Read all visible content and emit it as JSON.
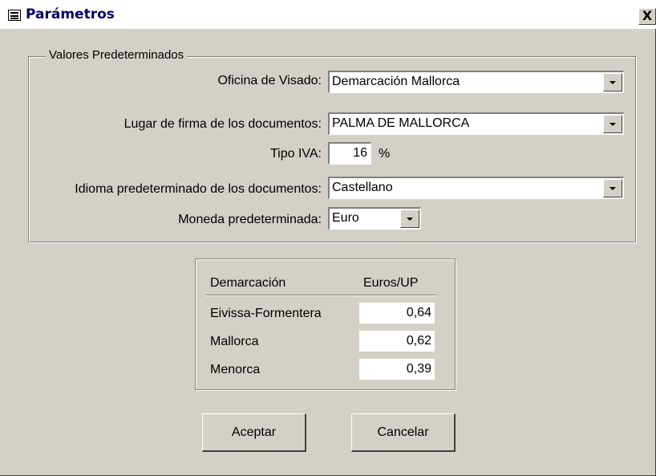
{
  "window": {
    "title": "Parámetros",
    "close_glyph": "X",
    "icon": "form-icon"
  },
  "defaults": {
    "legend": "Valores Predeterminados",
    "oficina": {
      "label": "Oficina de Visado:",
      "value": "Demarcación Mallorca"
    },
    "lugar": {
      "label": "Lugar de firma de los documentos:",
      "value": "PALMA DE MALLORCA"
    },
    "iva": {
      "label": "Tipo IVA:",
      "value": "16",
      "unit": "%"
    },
    "idioma": {
      "label": "Idioma predeterminado de los documentos:",
      "value": "Castellano"
    },
    "moneda": {
      "label": "Moneda predeterminada:",
      "value": "Euro"
    }
  },
  "rates": {
    "headers": [
      "Demarcación",
      "Euros/UP"
    ],
    "rows": [
      {
        "name": "Eivissa-Formentera",
        "value": "0,64"
      },
      {
        "name": "Mallorca",
        "value": "0,62"
      },
      {
        "name": "Menorca",
        "value": "0,39"
      }
    ]
  },
  "buttons": {
    "accept": "Aceptar",
    "cancel": "Cancelar"
  }
}
